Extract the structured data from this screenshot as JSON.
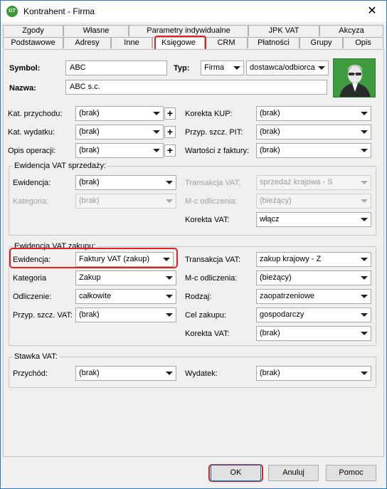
{
  "window": {
    "title": "Kontrahent - Firma",
    "icon_text": "GT"
  },
  "tabs_row1": [
    "Zgody",
    "Własne",
    "Parametry indywidualne",
    "JPK VAT",
    "Akcyza"
  ],
  "tabs_row2": [
    "Podstawowe",
    "Adresy",
    "Inne",
    "Księgowe",
    "CRM",
    "Płatności",
    "Grupy",
    "Opis"
  ],
  "active_tab": "Księgowe",
  "header": {
    "symbol_label": "Symbol:",
    "symbol_value": "ABC",
    "typ_label": "Typ:",
    "typ_value": "Firma",
    "typ2_value": "dostawca/odbiorca",
    "nazwa_label": "Nazwa:",
    "nazwa_value": "ABC s.c."
  },
  "general": {
    "kat_przychodu_label": "Kat. przychodu:",
    "kat_przychodu_value": "(brak)",
    "kat_wydatku_label": "Kat. wydatku:",
    "kat_wydatku_value": "(brak)",
    "opis_operacji_label": "Opis operacji:",
    "opis_operacji_value": "(brak)",
    "korekta_kup_label": "Korekta KUP:",
    "korekta_kup_value": "(brak)",
    "przyp_pit_label": "Przyp. szcz. PIT:",
    "przyp_pit_value": "(brak)",
    "wartosci_label": "Wartości z faktury:",
    "wartosci_value": "(brak)",
    "plus": "+"
  },
  "vat_sales": {
    "title": "Ewidencja VAT sprzedaży:",
    "ewidencja_label": "Ewidencja:",
    "ewidencja_value": "(brak)",
    "kategoria_label": "Kategoria:",
    "kategoria_value": "(brak)",
    "transakcja_label": "Transakcja VAT:",
    "transakcja_value": "sprzedaż krajowa - S",
    "mc_label": "M-c odliczenia:",
    "mc_value": "(bieżący)",
    "korekta_label": "Korekta VAT:",
    "korekta_value": "włącz"
  },
  "vat_purchase": {
    "title": "Ewidencja VAT zakupu:",
    "ewidencja_label": "Ewidencja:",
    "ewidencja_value": "Faktury VAT (zakup)",
    "kategoria_label": "Kategoria",
    "kategoria_value": "Zakup",
    "odliczenie_label": "Odliczenie:",
    "odliczenie_value": "całkowite",
    "przyp_vat_label": "Przyp. szcz. VAT:",
    "przyp_vat_value": "(brak)",
    "transakcja_label": "Transakcja VAT:",
    "transakcja_value": "zakup krajowy - Z",
    "mc_label": "M-c odliczenia:",
    "mc_value": "(bieżący)",
    "rodzaj_label": "Rodzaj:",
    "rodzaj_value": "zaopatrzeniowe",
    "cel_label": "Cel zakupu:",
    "cel_value": "gospodarczy",
    "korekta_label": "Korekta VAT:",
    "korekta_value": "(brak)"
  },
  "stawka": {
    "title": "Stawka VAT:",
    "przychod_label": "Przychód:",
    "przychod_value": "(brak)",
    "wydatek_label": "Wydatek:",
    "wydatek_value": "(brak)"
  },
  "buttons": {
    "ok": "OK",
    "cancel": "Anuluj",
    "help": "Pomoc"
  },
  "colors": {
    "highlight": "#e02020",
    "avatar_bg": "#3e9b3e",
    "border": "#2b79c2"
  }
}
